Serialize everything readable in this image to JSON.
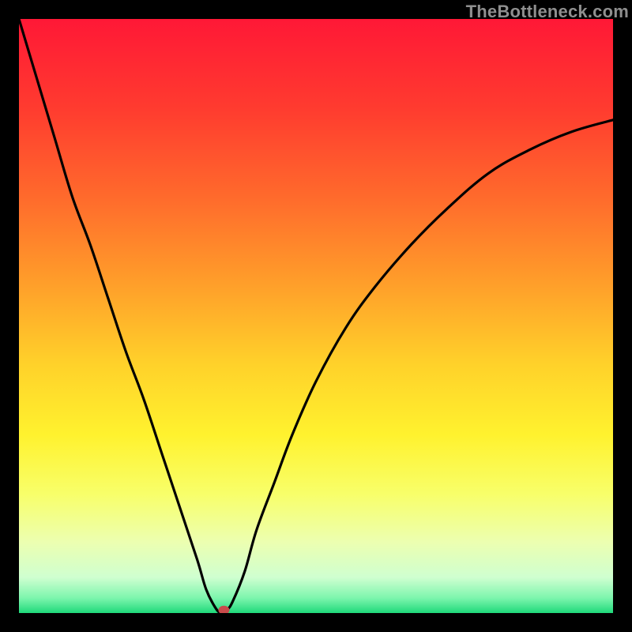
{
  "watermark": "TheBottleneck.com",
  "chart_data": {
    "type": "line",
    "title": "",
    "xlabel": "",
    "ylabel": "",
    "xlim": [
      0,
      100
    ],
    "ylim": [
      0,
      100
    ],
    "grid": false,
    "gradient_stops": [
      {
        "offset": 0.0,
        "color": "#ff1836"
      },
      {
        "offset": 0.15,
        "color": "#ff3b2f"
      },
      {
        "offset": 0.3,
        "color": "#ff6a2c"
      },
      {
        "offset": 0.45,
        "color": "#ffa02a"
      },
      {
        "offset": 0.58,
        "color": "#ffd12a"
      },
      {
        "offset": 0.7,
        "color": "#fff22e"
      },
      {
        "offset": 0.8,
        "color": "#f8ff6a"
      },
      {
        "offset": 0.88,
        "color": "#ecffb0"
      },
      {
        "offset": 0.94,
        "color": "#cfffd0"
      },
      {
        "offset": 0.975,
        "color": "#7cf5ad"
      },
      {
        "offset": 1.0,
        "color": "#1fd97a"
      }
    ],
    "series": [
      {
        "name": "bottleneck-curve",
        "x": [
          0,
          3,
          6,
          9,
          12,
          15,
          18,
          21,
          24,
          27,
          30,
          31.5,
          33,
          34,
          35,
          36,
          38,
          40,
          43,
          46,
          50,
          55,
          60,
          66,
          72,
          79,
          86,
          93,
          100
        ],
        "values": [
          100,
          90,
          80,
          70,
          62,
          53,
          44,
          36,
          27,
          18,
          9,
          4,
          1,
          0,
          0.5,
          2,
          7,
          14,
          22,
          30,
          39,
          48,
          55,
          62,
          68,
          74,
          78,
          81,
          83
        ]
      }
    ],
    "marker": {
      "x": 34.5,
      "y": 0.5,
      "color": "#c94b4b",
      "radius_px": 7
    },
    "annotations": []
  }
}
